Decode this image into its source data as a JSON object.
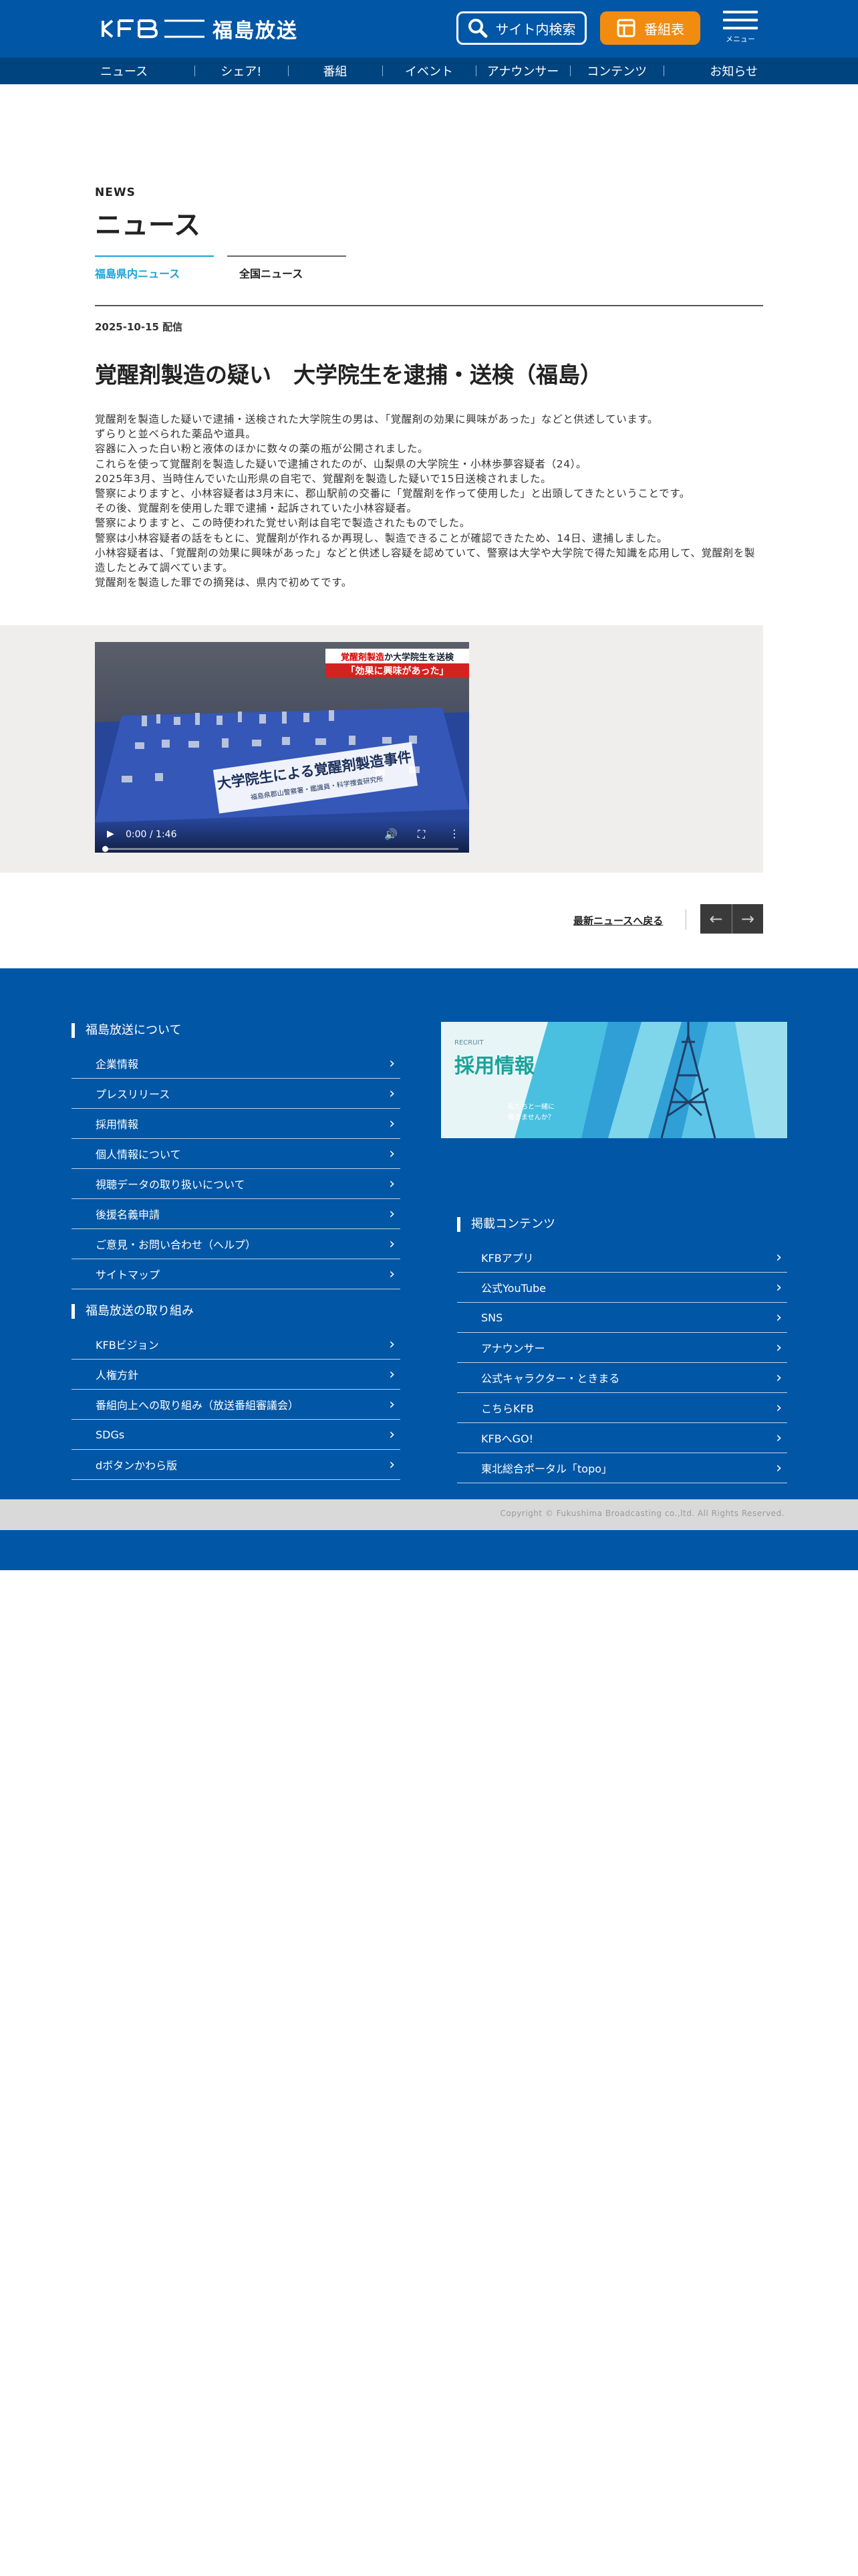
{
  "header": {
    "logo_text": "福島放送",
    "search_label": "サイト内検索",
    "guide_label": "番組表",
    "menu_label": "メニュー"
  },
  "nav": [
    "ニュース",
    "シェア!",
    "番組",
    "イベント",
    "アナウンサー",
    "コンテンツ",
    "お知らせ"
  ],
  "main": {
    "eyebrow": "NEWS",
    "title": "ニュース",
    "tabs": [
      {
        "label": "福島県内ニュース",
        "active": true
      },
      {
        "label": "全国ニュース",
        "active": false
      }
    ],
    "date": "2025-10-15 配信",
    "headline": "覚醒剤製造の疑い　大学院生を逮捕・送検（福島）",
    "body": [
      "覚醒剤を製造した疑いで逮捕・送検された大学院生の男は、「覚醒剤の効果に興味があった」などと供述しています。",
      "ずらりと並べられた薬品や道具。",
      "容器に入った白い粉と液体のほかに数々の薬の瓶が公開されました。",
      "これらを使って覚醒剤を製造した疑いで逮捕されたのが、山梨県の大学院生・小林歩夢容疑者（24）。",
      "2025年3月、当時住んでいた山形県の自宅で、覚醒剤を製造した疑いで15日送検されました。",
      "警察によりますと、小林容疑者は3月末に、郡山駅前の交番に「覚醒剤を作って使用した」と出頭してきたということです。",
      "その後、覚醒剤を使用した罪で逮捕・起訴されていた小林容疑者。",
      "警察によりますと、この時使われた覚せい剤は自宅で製造されたものでした。",
      "警察は小林容疑者の話をもとに、覚醒剤が作れるか再現し、製造できることが確認できたため、14日、逮捕しました。",
      "小林容疑者は、「覚醒剤の効果に興味があった」などと供述し容疑を認めていて、警察は大学や大学院で得た知識を応用して、覚醒剤を製",
      "造したとみて調べています。",
      "覚醒剤を製造した罪での摘発は、県内で初めてです。"
    ],
    "video": {
      "tag_line1_red": "覚醒剤製造",
      "tag_line1_rest": "か大学院生を送検",
      "tag_line2": "「効果に興味があった」",
      "caption_main": "大学院生による覚醒剤製造事件",
      "caption_sub": "福島県郡山警察署・鑑識員・科学捜査研究所",
      "time": "0:00 / 1:46",
      "progress": 0
    },
    "back_link": "最新ニュースへ戻る"
  },
  "footer": {
    "about_heading": "福島放送について",
    "about_items": [
      "企業情報",
      "プレスリリース",
      "採用情報",
      "個人情報について",
      "視聴データの取り扱いについて",
      "後援名義申請",
      "ご意見・お問い合わせ（ヘルプ）",
      "サイトマップ"
    ],
    "efforts_heading": "福島放送の取り組み",
    "efforts_items": [
      "KFBビジョン",
      "人権方針",
      "番組向上への取り組み（放送番組審議会）",
      "SDGs",
      "dボタンかわら版"
    ],
    "banner": {
      "small": "RECRUIT",
      "title": "採用情報",
      "sub1": "私たちと一緒に",
      "sub2": "働きませんか？"
    },
    "contents_heading": "掲載コンテンツ",
    "contents_items": [
      "KFBアプリ",
      "公式YouTube",
      "SNS",
      "アナウンサー",
      "公式キャラクター・ときまる",
      "こちらKFB",
      "KFBへGO!",
      "東北総合ポータル「topo」"
    ],
    "copyright": "Copyright © Fukushima Broadcasting co.,ltd. All Rights Reserved."
  },
  "colors": {
    "brand_blue": "#0156a6",
    "nav_blue": "#00447f",
    "orange": "#f28c0f",
    "accent_cyan": "#1aa3d6"
  }
}
